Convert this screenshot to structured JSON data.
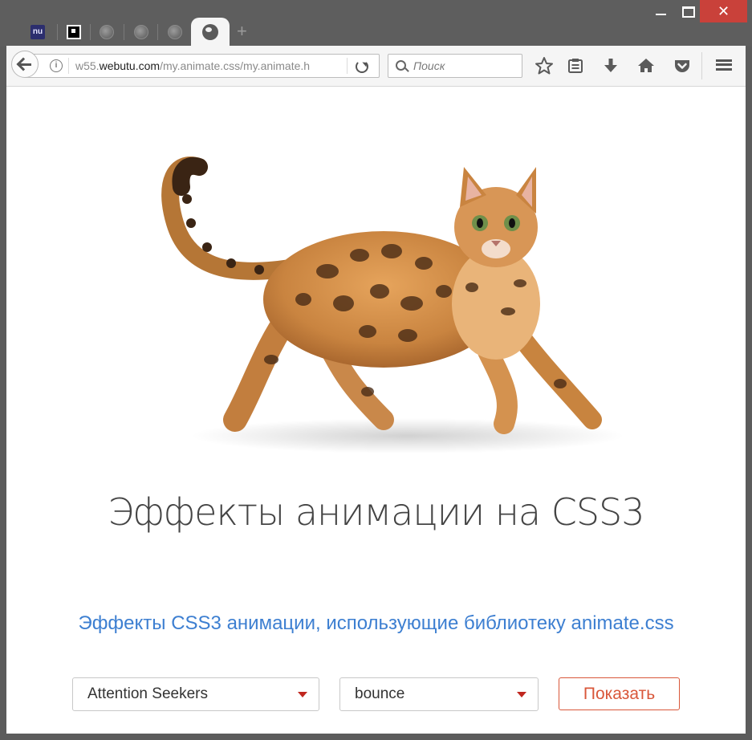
{
  "browser": {
    "tabs": [
      {
        "icon": "nu-favicon-icon",
        "label": "nu"
      },
      {
        "icon": "qr-favicon-icon"
      },
      {
        "icon": "globe-icon"
      },
      {
        "icon": "globe-icon"
      },
      {
        "icon": "globe-icon"
      },
      {
        "icon": "globe-icon",
        "active": true
      }
    ],
    "new_tab": "+",
    "url_prefix": "w55.",
    "url_domain": "webutu.com",
    "url_path": "/my.animate.css/my.animate.h",
    "search_placeholder": "Поиск",
    "toolbar_icons": [
      "star-icon",
      "reading-list-icon",
      "download-icon",
      "home-icon",
      "pocket-icon",
      "menu-icon"
    ],
    "info_glyph": "i",
    "close_glyph": "✕"
  },
  "page": {
    "title": "Эффекты анимации на CSS3",
    "subtitle": "Эффекты CSS3 анимации, использующие библиотеку animate.css",
    "group_select": {
      "value": "Attention Seekers"
    },
    "effect_select": {
      "value": "bounce"
    },
    "show_button": "Показать"
  },
  "colors": {
    "accent_blue": "#3d7fd1",
    "button_red": "#d9573a",
    "arrow_red": "#c0271f",
    "close_red": "#c9413a"
  }
}
